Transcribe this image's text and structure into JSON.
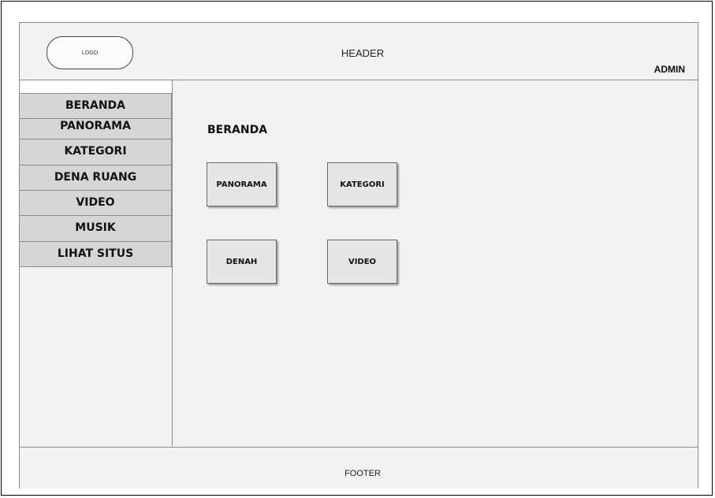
{
  "header": {
    "logo_label": "LOGO",
    "title": "HEADER",
    "user_label": "ADMIN"
  },
  "sidebar": {
    "items": [
      {
        "label": "BERANDA"
      },
      {
        "label": "PANORAMA"
      },
      {
        "label": "KATEGORI"
      },
      {
        "label": "DENA RUANG"
      },
      {
        "label": "VIDEO"
      },
      {
        "label": "MUSIK"
      },
      {
        "label": "LIHAT SITUS"
      }
    ]
  },
  "main": {
    "title": "BERANDA",
    "tiles": [
      {
        "label": "PANORAMA"
      },
      {
        "label": "KATEGORI"
      },
      {
        "label": "DENAH"
      },
      {
        "label": "VIDEO"
      }
    ]
  },
  "footer": {
    "text": "FOOTER"
  }
}
